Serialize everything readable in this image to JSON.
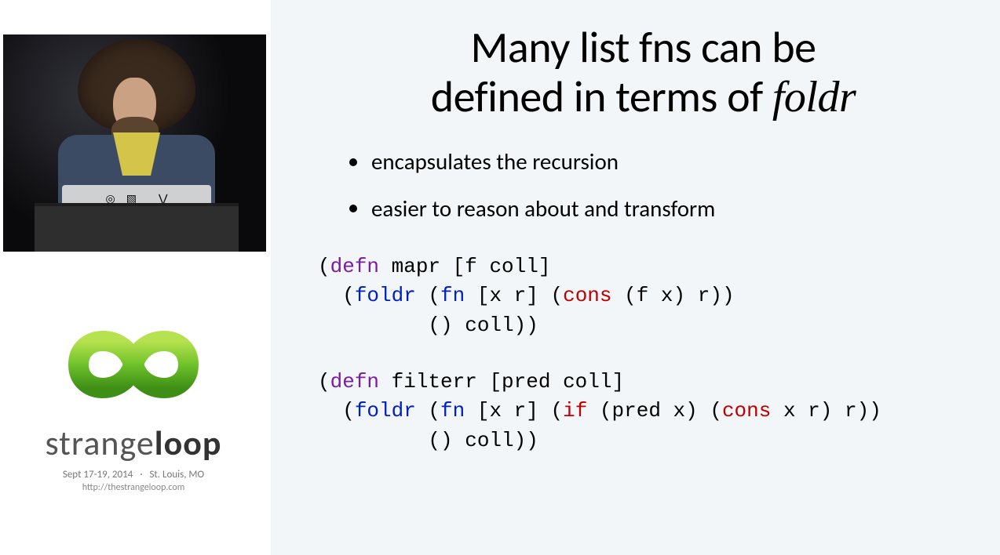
{
  "conference": {
    "wordmark_a": "strange",
    "wordmark_b": "loop",
    "dates": "Sept 17-19, 2014",
    "location": "St. Louis, MO",
    "url": "http://thestrangeloop.com"
  },
  "speaker": {
    "laptop_stickers": [
      "◎",
      "▧",
      "",
      "⋁"
    ]
  },
  "slide": {
    "title_a": "Many list fns can be",
    "title_b": "defined in terms of ",
    "title_em": "foldr",
    "bullets": [
      "encapsulates the recursion",
      "easier to reason about and transform"
    ],
    "code1": {
      "tokens": [
        [
          [
            "(",
            "p"
          ],
          [
            "defn",
            "kw-def"
          ],
          [
            " mapr [f coll]",
            "p"
          ]
        ],
        [
          [
            "  (",
            "p"
          ],
          [
            "foldr",
            "kw-call"
          ],
          [
            " (",
            "p"
          ],
          [
            "fn",
            "kw-call"
          ],
          [
            " [x r] (",
            "p"
          ],
          [
            "cons",
            "kw-core"
          ],
          [
            " (f x) r))",
            "p"
          ]
        ],
        [
          [
            "         () coll))",
            "p"
          ]
        ]
      ]
    },
    "code2": {
      "tokens": [
        [
          [
            "(",
            "p"
          ],
          [
            "defn",
            "kw-def"
          ],
          [
            " filterr [pred coll]",
            "p"
          ]
        ],
        [
          [
            "  (",
            "p"
          ],
          [
            "foldr",
            "kw-call"
          ],
          [
            " (",
            "p"
          ],
          [
            "fn",
            "kw-call"
          ],
          [
            " [x r] (",
            "p"
          ],
          [
            "if",
            "kw-core"
          ],
          [
            " (pred x) (",
            "p"
          ],
          [
            "cons",
            "kw-core"
          ],
          [
            " x r) r))",
            "p"
          ]
        ],
        [
          [
            "         () coll))",
            "p"
          ]
        ]
      ]
    }
  }
}
